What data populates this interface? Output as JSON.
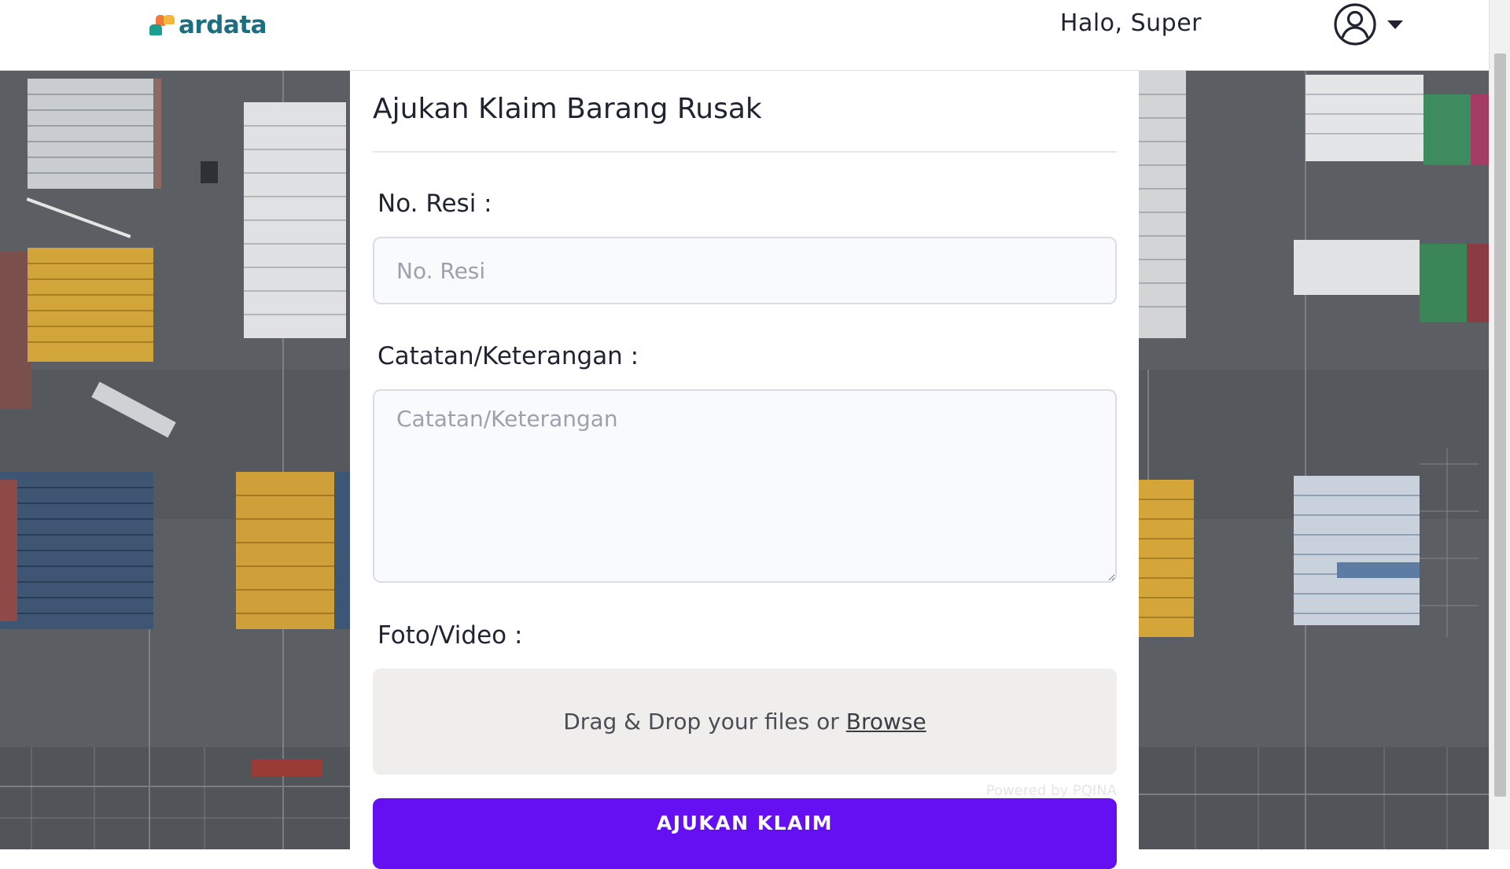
{
  "header": {
    "logo_text": "ardata",
    "greeting": "Halo, Super",
    "avatar_icon": "user-circle-icon",
    "menu_icon": "caret-down-icon"
  },
  "form": {
    "title": "Ajukan Klaim Barang Rusak",
    "resi": {
      "label": "No. Resi :",
      "placeholder": "No. Resi",
      "value": ""
    },
    "notes": {
      "label": "Catatan/Keterangan :",
      "placeholder": "Catatan/Keterangan",
      "value": ""
    },
    "media": {
      "label": "Foto/Video :",
      "drop_text": "Drag & Drop your files or",
      "browse_label": "Browse",
      "powered_by": "Powered by PQINA"
    },
    "submit_label": "AJUKAN KLAIM"
  },
  "colors": {
    "accent": "#6510f2",
    "logo_teal": "#1c6f7f",
    "logo_orange": "#ef7b3a",
    "logo_yellow": "#f4b63d",
    "logo_green": "#1f9e8f",
    "page_background": "#5a5d61"
  }
}
